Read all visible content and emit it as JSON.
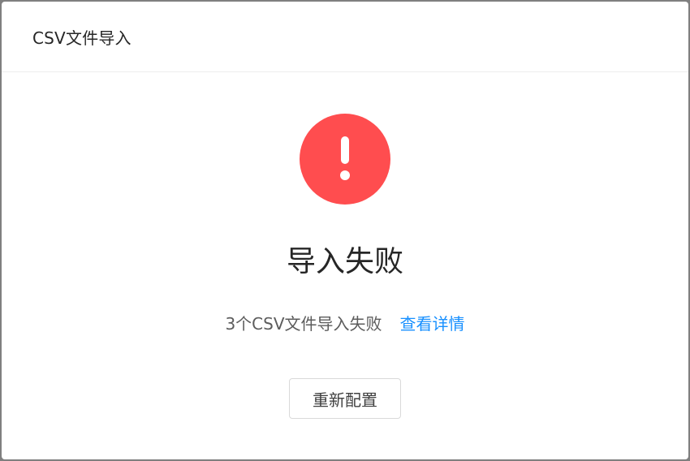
{
  "dialog": {
    "title": "CSV文件导入"
  },
  "result": {
    "status": "error",
    "icon": "exclamation-circle-icon",
    "icon_color": "#ff4d4f",
    "title": "导入失败",
    "subtitle": "3个CSV文件导入失败",
    "detail_link": "查看详情",
    "link_color": "#1890ff",
    "action_button": "重新配置"
  }
}
